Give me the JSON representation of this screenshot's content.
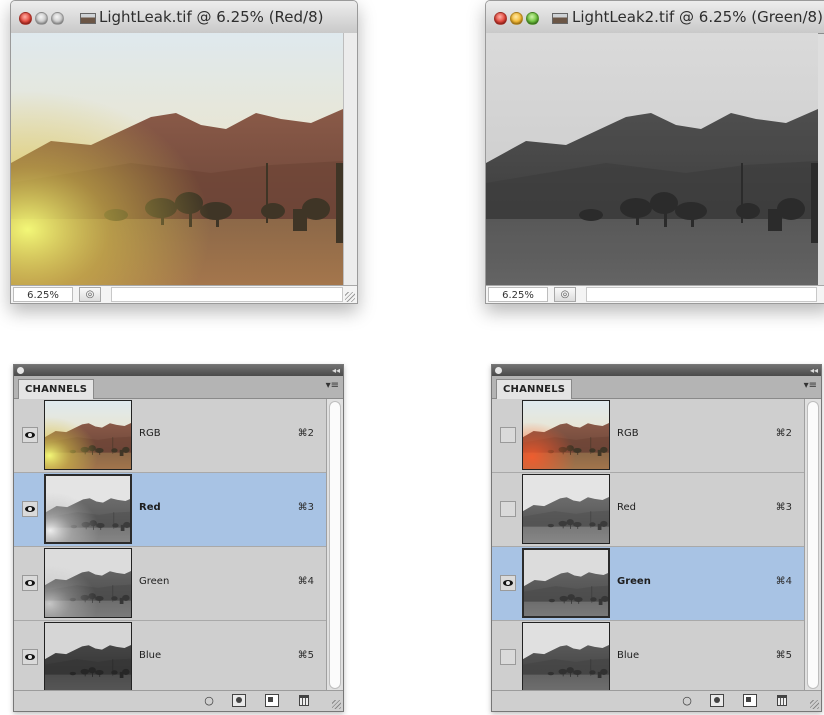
{
  "colors": {
    "selection": "#a8c3e4",
    "panel_bg": "#cfcfcf",
    "title_close": "#e2453a",
    "title_minimize": "#f3b730",
    "title_zoom": "#6bc13b"
  },
  "windows": [
    {
      "title": "LightLeak.tif @ 6.25% (Red/8)",
      "zoom": "6.25%",
      "active": false,
      "photo_mode": "color"
    },
    {
      "title": "LightLeak2.tif @ 6.25% (Green/8)",
      "zoom": "6.25%",
      "active": true,
      "photo_mode": "grayscale"
    }
  ],
  "panels": [
    {
      "tab": "CHANNELS",
      "channels": [
        {
          "name": "RGB",
          "shortcut": "⌘2",
          "visible": true,
          "selected": false,
          "thumb": "color"
        },
        {
          "name": "Red",
          "shortcut": "⌘3",
          "visible": true,
          "selected": true,
          "thumb": "red"
        },
        {
          "name": "Green",
          "shortcut": "⌘4",
          "visible": true,
          "selected": false,
          "thumb": "green"
        },
        {
          "name": "Blue",
          "shortcut": "⌘5",
          "visible": true,
          "selected": false,
          "thumb": "blue"
        }
      ],
      "footer_icons": [
        "selection-circle-icon",
        "mask-icon",
        "new-channel-icon",
        "trash-icon"
      ]
    },
    {
      "tab": "CHANNELS",
      "channels": [
        {
          "name": "RGB",
          "shortcut": "⌘2",
          "visible": false,
          "selected": false,
          "thumb": "color-reddish"
        },
        {
          "name": "Red",
          "shortcut": "⌘3",
          "visible": false,
          "selected": false,
          "thumb": "red"
        },
        {
          "name": "Green",
          "shortcut": "⌘4",
          "visible": true,
          "selected": true,
          "thumb": "green"
        },
        {
          "name": "Blue",
          "shortcut": "⌘5",
          "visible": false,
          "selected": false,
          "thumb": "blue"
        }
      ],
      "footer_icons": [
        "selection-circle-icon",
        "mask-icon",
        "new-channel-icon",
        "trash-icon"
      ]
    }
  ]
}
